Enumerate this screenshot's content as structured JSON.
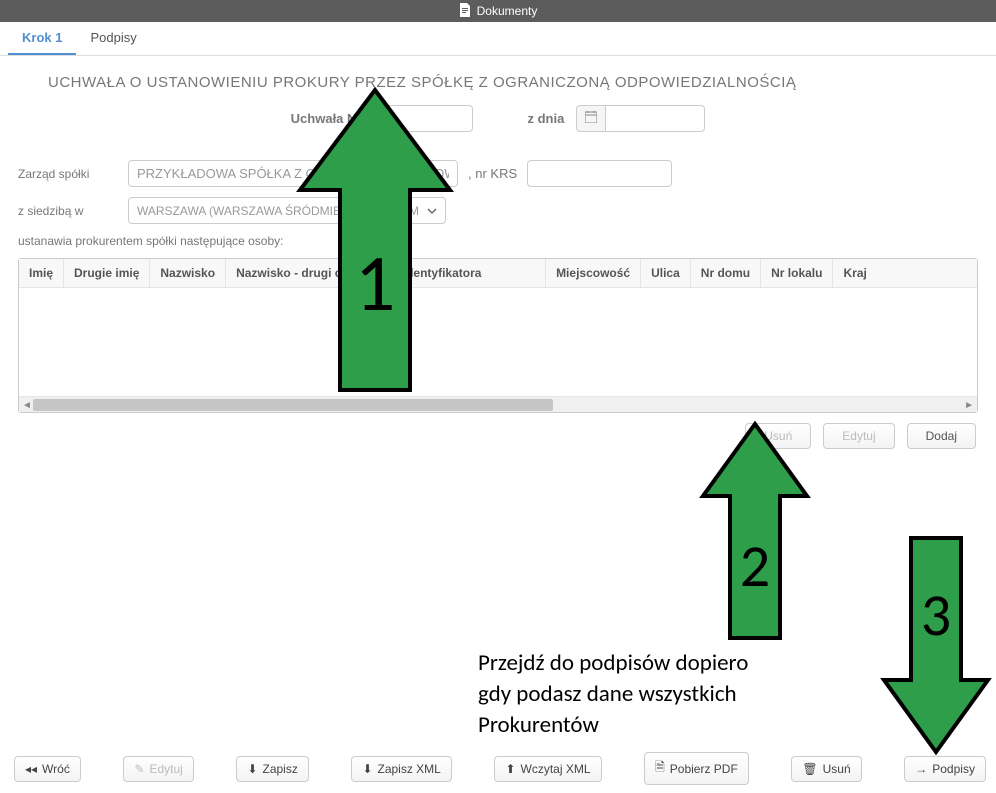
{
  "title_bar": {
    "icon": "document-icon",
    "text": "Dokumenty"
  },
  "tabs": [
    {
      "label": "Krok 1",
      "active": true
    },
    {
      "label": "Podpisy",
      "active": false
    }
  ],
  "document": {
    "title": "UCHWAŁA O USTANOWIENIU PROKURY PRZEZ SPÓŁKĘ Z OGRANICZONĄ ODPOWIEDZIALNOŚCIĄ",
    "number_label": "Uchwała Nr",
    "number_value": "",
    "date_label": "z dnia",
    "date_value": ""
  },
  "form": {
    "zarzad_label": "Zarząd spółki",
    "zarzad_value": "PRZYKŁADOWA SPÓŁKA Z OGRANICZONĄ ODPOWIEDZIALNOŚCIĄ",
    "krs_label": ", nr KRS",
    "krs_value": "",
    "siedziba_label": "z siedzibą w",
    "siedziba_value": "WARSZAWA (WARSZAWA ŚRÓDMIEŚCIE, WOJ. MAZOWIECKIE)",
    "ustanawia_text": "ustanawia prokurentem spółki następujące osoby:"
  },
  "grid": {
    "headers": [
      "Imię",
      "Drugie imię",
      "Nazwisko",
      "Nazwisko - drugi człon",
      "Nr identyfikatora",
      "Miejscowość",
      "Ulica",
      "Nr domu",
      "Nr lokalu",
      "Kraj"
    ],
    "rows": []
  },
  "grid_buttons": {
    "delete": "Usuń",
    "edit": "Edytuj",
    "add": "Dodaj"
  },
  "footer_buttons": {
    "back": "Wróć",
    "edit": "Edytuj",
    "save": "Zapisz",
    "save_xml": "Zapisz XML",
    "load_xml": "Wczytaj XML",
    "download_pdf": "Pobierz PDF",
    "delete": "Usuń",
    "signatures": "Podpisy"
  },
  "annotation": {
    "text_line1": "Przejdź do podpisów dopiero",
    "text_line2": "gdy podasz dane wszystkich",
    "text_line3": "Prokurentów",
    "arrow1": "1",
    "arrow2": "2",
    "arrow3": "3"
  }
}
